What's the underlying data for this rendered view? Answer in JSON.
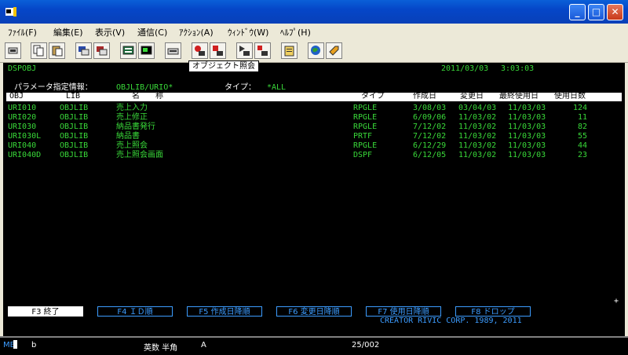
{
  "menu": [
    "ﾌｧｲﾙ(F)",
    "編集(E)",
    "表示(V)",
    "通信(C)",
    "ｱｸｼｮﾝ(A)",
    "ｳｨﾝﾄﾞｳ(W)",
    "ﾍﾙﾌﾟ(H)"
  ],
  "tooltip": "オブジェクト照会",
  "screen": {
    "program": "DSPOBJ",
    "date": "2011/03/03",
    "time": "3:03:03",
    "param_label": "パラメータ指定情報：",
    "param_value": "OBJLIB/URIO*",
    "type_label": "タイプ：",
    "type_value": "*ALL",
    "headers": {
      "obj": "OBJ",
      "lib": "LIB",
      "name": "名　　称",
      "type": "タイプ",
      "created": "作成日",
      "changed": "変更日",
      "last_used": "最終使用日",
      "days_used": "使用日数"
    },
    "rows": [
      {
        "obj": "URI010",
        "lib": "OBJLIB",
        "name": "売上入力",
        "type": "RPGLE",
        "created": "3/08/03",
        "changed": "03/04/03",
        "last_used": "11/03/03",
        "days": "124"
      },
      {
        "obj": "URI020",
        "lib": "OBJLIB",
        "name": "売上修正",
        "type": "RPGLE",
        "created": "6/09/06",
        "changed": "11/03/02",
        "last_used": "11/03/03",
        "days": "11"
      },
      {
        "obj": "URI030",
        "lib": "OBJLIB",
        "name": "納品書発行",
        "type": "RPGLE",
        "created": "7/12/02",
        "changed": "11/03/02",
        "last_used": "11/03/03",
        "days": "82"
      },
      {
        "obj": "URI030L",
        "lib": "OBJLIB",
        "name": "納品書",
        "type": "PRTF",
        "created": "7/12/02",
        "changed": "11/03/02",
        "last_used": "11/03/03",
        "days": "55"
      },
      {
        "obj": "URI040",
        "lib": "OBJLIB",
        "name": "売上照会",
        "type": "RPGLE",
        "created": "6/12/29",
        "changed": "11/03/02",
        "last_used": "11/03/03",
        "days": "44"
      },
      {
        "obj": "URI040D",
        "lib": "OBJLIB",
        "name": "売上照会画面",
        "type": "DSPF",
        "created": "6/12/05",
        "changed": "11/03/02",
        "last_used": "11/03/03",
        "days": "23"
      }
    ],
    "more_indicator": "+",
    "fkeys": [
      "F3 終了",
      "F4 ＩＤ順",
      "F5 作成日降順",
      "F6 変更日降順",
      "F7 使用日降順",
      "F8 ドロップ"
    ],
    "copyright": "CREATOR RIVIC CORP. 1989, 2011"
  },
  "status": {
    "mode": "MB",
    "indicator": "b",
    "input_mode": "英数 半角",
    "field": "A",
    "position": "25/002"
  },
  "colors": {
    "screen_fg": "#39d839",
    "screen_bg": "#000000",
    "accent": "#3c9cff"
  }
}
